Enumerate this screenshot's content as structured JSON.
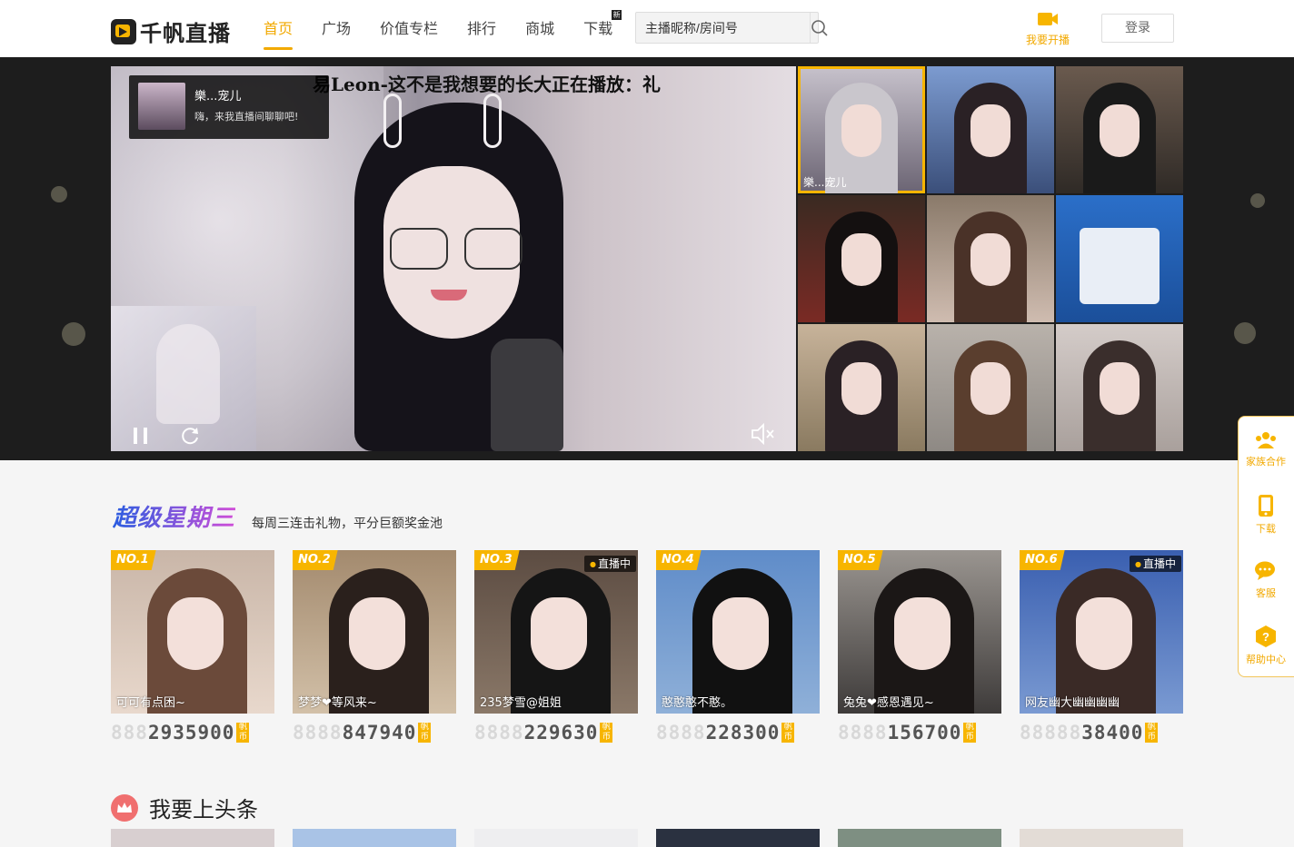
{
  "header": {
    "logo_text": "千帆直播",
    "nav": [
      {
        "label": "首页",
        "active": true
      },
      {
        "label": "广场",
        "active": false
      },
      {
        "label": "价值专栏",
        "active": false
      },
      {
        "label": "排行",
        "active": false
      },
      {
        "label": "商城",
        "active": false
      },
      {
        "label": "下载",
        "active": false,
        "badge": "新"
      }
    ],
    "search": {
      "placeholder": "主播昵称/房间号",
      "icon": "search-icon"
    },
    "broadcast_label": "我要开播",
    "login_label": "登录"
  },
  "hero": {
    "marquee": "易Leon-这不是我想要的长大正在播放：礼",
    "streamer": {
      "name": "樂...宠儿",
      "message": "嗨，来我直播间聊聊吧!"
    },
    "controls": [
      "pause-icon",
      "refresh-icon",
      "mute-icon"
    ],
    "thumbnails": [
      {
        "label": "樂...宠儿",
        "active": true
      },
      {
        "label": ""
      },
      {
        "label": ""
      },
      {
        "label": ""
      },
      {
        "label": ""
      },
      {
        "label": ""
      },
      {
        "label": ""
      },
      {
        "label": ""
      },
      {
        "label": ""
      }
    ]
  },
  "super_wednesday": {
    "title": "超级星期三",
    "subtitle": "每周三连击礼物，平分巨额奖金池",
    "coin_tag": "帆币",
    "cards": [
      {
        "rank": "NO.1",
        "name": "可可有点困~",
        "pad": "888",
        "score": "2935900",
        "live": false
      },
      {
        "rank": "NO.2",
        "name": "梦梦❤等风来~",
        "pad": "8888",
        "score": "847940",
        "live": false
      },
      {
        "rank": "NO.3",
        "name": "235梦雪@姐姐",
        "pad": "8888",
        "score": "229630",
        "live": true
      },
      {
        "rank": "NO.4",
        "name": "憨憨憨不憨。",
        "pad": "8888",
        "score": "228300",
        "live": false
      },
      {
        "rank": "NO.5",
        "name": "兔兔❤感恩遇见~",
        "pad": "8888",
        "score": "156700",
        "live": false
      },
      {
        "rank": "NO.6",
        "name": "网友幽大幽幽幽幽",
        "pad": "88888",
        "score": "38400",
        "live": true
      }
    ],
    "live_label": "直播中"
  },
  "headline": {
    "title": "我要上头条"
  },
  "sidebar": [
    {
      "label": "家族合作",
      "icon": "family-icon"
    },
    {
      "label": "下载",
      "icon": "phone-icon"
    },
    {
      "label": "客服",
      "icon": "chat-icon"
    },
    {
      "label": "帮助中心",
      "icon": "help-icon"
    }
  ],
  "colors": {
    "accent": "#f7b500",
    "accent_text": "#f2a900",
    "hero_bg": "#1d1d1d"
  }
}
